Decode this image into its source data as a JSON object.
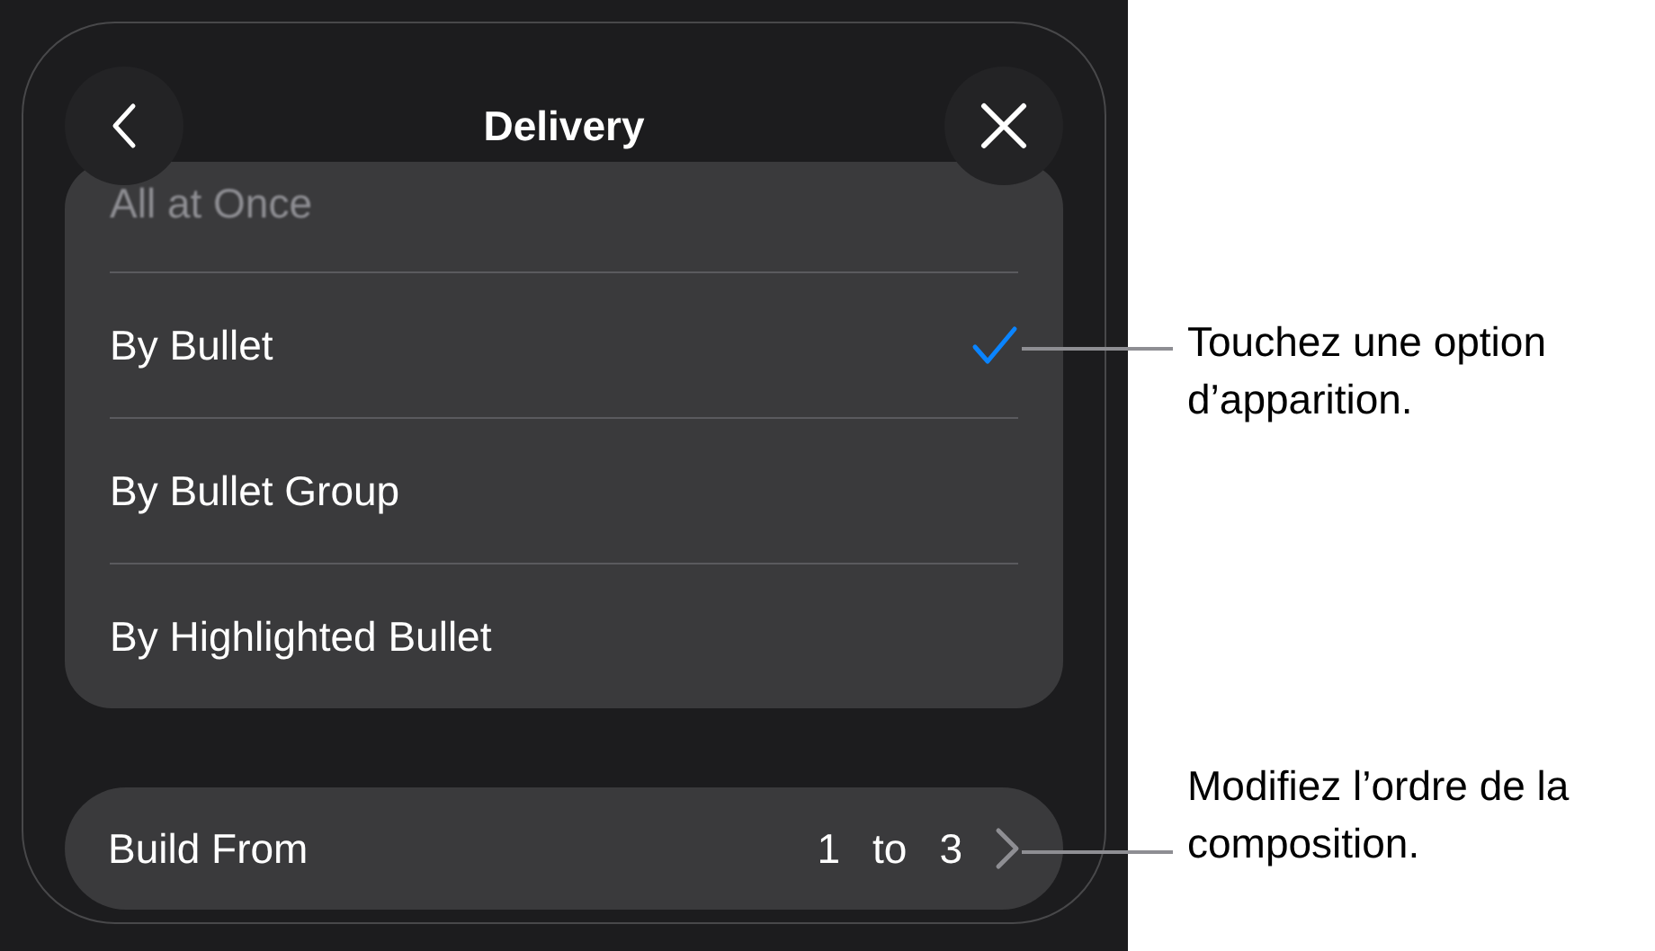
{
  "header": {
    "title": "Delivery"
  },
  "options": [
    {
      "label": "All at Once",
      "faded": true,
      "selected": false
    },
    {
      "label": "By Bullet",
      "faded": false,
      "selected": true
    },
    {
      "label": "By Bullet Group",
      "faded": false,
      "selected": false
    },
    {
      "label": "By Highlighted Bullet",
      "faded": false,
      "selected": false
    }
  ],
  "build_from": {
    "label": "Build From",
    "from": "1",
    "connector": "to",
    "to": "3"
  },
  "callouts": [
    "Touchez une option d’apparition.",
    "Modifiez l’ordre de la composition."
  ]
}
